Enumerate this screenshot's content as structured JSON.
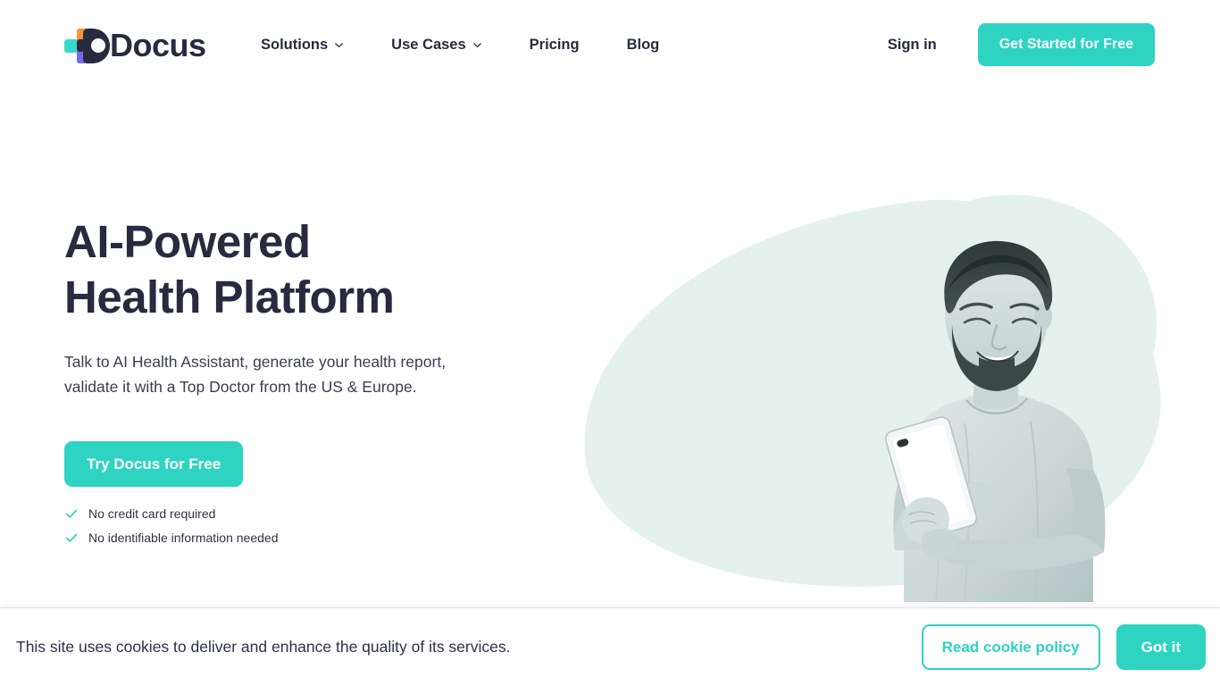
{
  "brand": {
    "name": "Docus",
    "logo_icon": "docus-logo-icon",
    "colors": {
      "teal": "#2ed3c2",
      "navy": "#282b3f",
      "orange": "#f79439",
      "purple": "#7b68ee",
      "blob_mint": "#e4f1ed"
    }
  },
  "header": {
    "nav": [
      {
        "label": "Solutions",
        "has_dropdown": true,
        "icon": "chevron-down-icon"
      },
      {
        "label": "Use Cases",
        "has_dropdown": true,
        "icon": "chevron-down-icon"
      },
      {
        "label": "Pricing",
        "has_dropdown": false
      },
      {
        "label": "Blog",
        "has_dropdown": false
      }
    ],
    "sign_in_label": "Sign in",
    "cta_label": "Get Started for Free"
  },
  "hero": {
    "title": "AI-Powered Health Platform",
    "subtitle": "Talk to AI Health Assistant, generate your health report, validate it with a Top Doctor from the US & Europe.",
    "cta_label": "Try Docus for Free",
    "points": [
      {
        "icon": "check-icon",
        "label": "No credit card required"
      },
      {
        "icon": "check-icon",
        "label": "No identifiable information needed"
      }
    ],
    "image_alt": "Smiling bearded man in a grey t-shirt looking at his smartphone"
  },
  "cookie_banner": {
    "message": "This site uses cookies to deliver and enhance the quality of its services.",
    "policy_label": "Read cookie policy",
    "accept_label": "Got it"
  }
}
